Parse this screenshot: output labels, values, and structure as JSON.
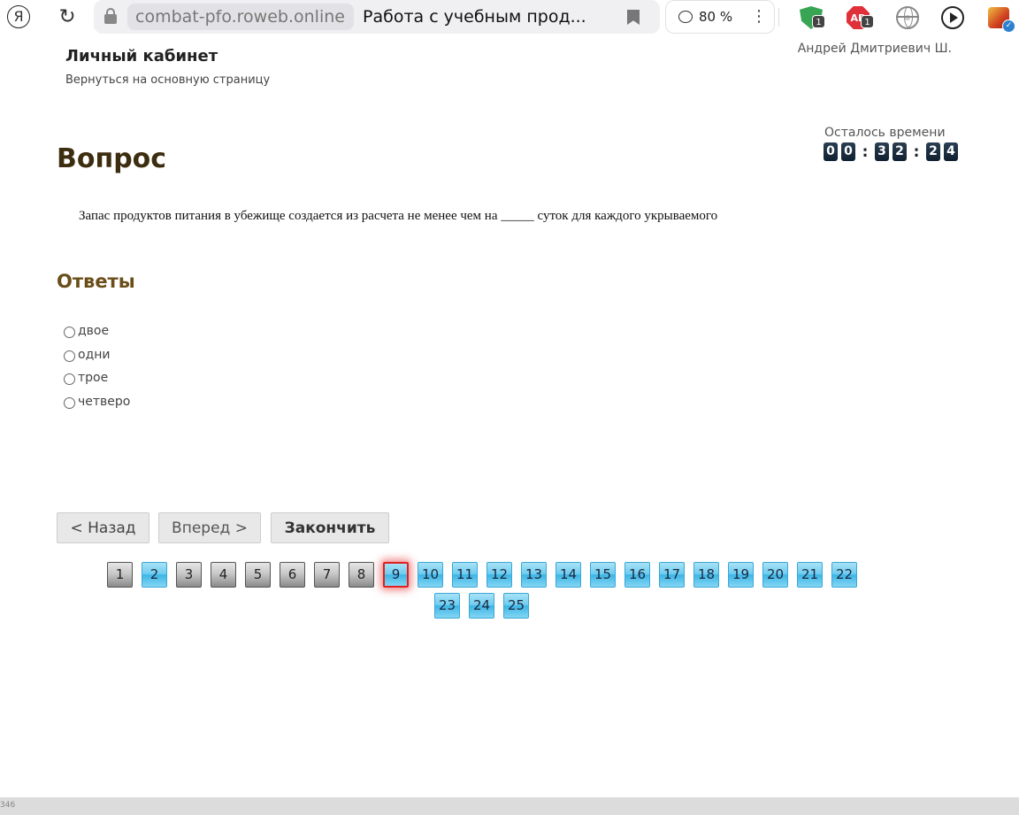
{
  "browser": {
    "logo": "Я",
    "domain": "combat-pfo.roweb.online",
    "tab_title": "Работа с учебным прод...",
    "zoom": "80 %",
    "extensions": [
      {
        "name": "shield",
        "badge": "1"
      },
      {
        "name": "adblock",
        "text": "AB",
        "badge": "1"
      }
    ]
  },
  "header": {
    "title": "Личный кабинет",
    "back_link": "Вернуться на основную страницу",
    "user": "Андрей Дмитриевич Ш."
  },
  "timer": {
    "label": "Осталось времени",
    "digits": [
      "0",
      "0",
      "3",
      "2",
      "2",
      "4"
    ]
  },
  "question": {
    "heading": "Вопрос",
    "text": "Запас продуктов питания в убежище создается из расчета не менее чем на _____ суток для каждого укрываемого"
  },
  "answers": {
    "heading": "Ответы",
    "options": [
      "двое",
      "одни",
      "трое",
      "четверо"
    ]
  },
  "buttons": {
    "back": "< Назад",
    "forward": "Вперед >",
    "finish": "Закончить"
  },
  "pager": {
    "current": 9,
    "pages": [
      {
        "label": "1",
        "state": "done"
      },
      {
        "label": "2",
        "state": "open"
      },
      {
        "label": "3",
        "state": "done"
      },
      {
        "label": "4",
        "state": "done"
      },
      {
        "label": "5",
        "state": "done"
      },
      {
        "label": "6",
        "state": "done"
      },
      {
        "label": "7",
        "state": "done"
      },
      {
        "label": "8",
        "state": "done"
      },
      {
        "label": "9",
        "state": "current"
      },
      {
        "label": "10",
        "state": "open"
      },
      {
        "label": "11",
        "state": "open"
      },
      {
        "label": "12",
        "state": "open"
      },
      {
        "label": "13",
        "state": "open"
      },
      {
        "label": "14",
        "state": "open"
      },
      {
        "label": "15",
        "state": "open"
      },
      {
        "label": "16",
        "state": "open"
      },
      {
        "label": "17",
        "state": "open"
      },
      {
        "label": "18",
        "state": "open"
      },
      {
        "label": "19",
        "state": "open"
      },
      {
        "label": "20",
        "state": "open"
      },
      {
        "label": "21",
        "state": "open"
      },
      {
        "label": "22",
        "state": "open"
      },
      {
        "label": "23",
        "state": "open"
      },
      {
        "label": "24",
        "state": "open"
      },
      {
        "label": "25",
        "state": "open"
      }
    ]
  },
  "status": {
    "text": "346"
  }
}
